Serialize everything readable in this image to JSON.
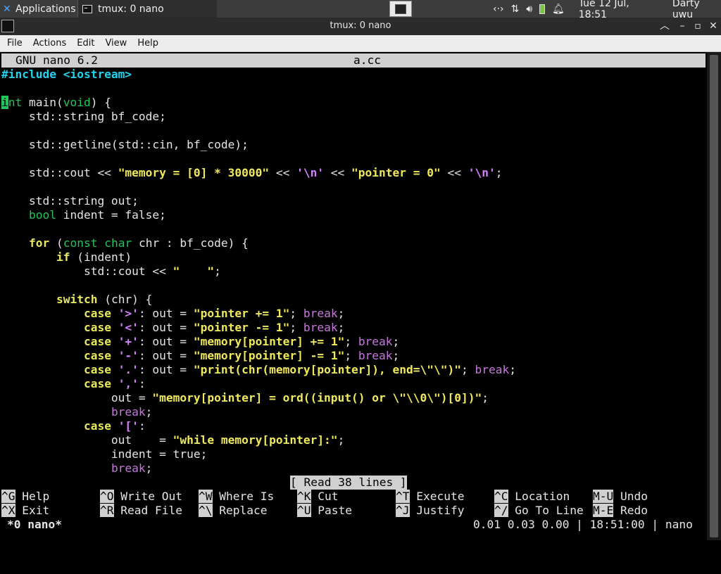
{
  "panel": {
    "apps_label": "Applications",
    "task_label": "tmux: 0 nano",
    "clock": "Tue 12 Jul, 18:51",
    "user": "Darty uwu"
  },
  "window": {
    "title": "tmux: 0 nano"
  },
  "menu": [
    "File",
    "Actions",
    "Edit",
    "View",
    "Help"
  ],
  "nano": {
    "version": "GNU nano 6.2",
    "filename": "a.cc",
    "status_message": "[ Read 38 lines ]",
    "shortcuts_row1": [
      {
        "key": "^G",
        "label": "Help"
      },
      {
        "key": "^O",
        "label": "Write Out"
      },
      {
        "key": "^W",
        "label": "Where Is"
      },
      {
        "key": "^K",
        "label": "Cut"
      },
      {
        "key": "^T",
        "label": "Execute"
      },
      {
        "key": "^C",
        "label": "Location"
      },
      {
        "key": "M-U",
        "label": "Undo"
      }
    ],
    "shortcuts_row2": [
      {
        "key": "^X",
        "label": "Exit"
      },
      {
        "key": "^R",
        "label": "Read File"
      },
      {
        "key": "^\\",
        "label": "Replace"
      },
      {
        "key": "^U",
        "label": "Paste"
      },
      {
        "key": "^J",
        "label": "Justify"
      },
      {
        "key": "^/",
        "label": "Go To Line"
      },
      {
        "key": "M-E",
        "label": "Redo"
      }
    ]
  },
  "tmux": {
    "window": "*0 nano*",
    "status_right": "0.01 0.03 0.00 | 18:51:00 | nano"
  },
  "code": [
    "#include <iostream>",
    "",
    "int main(void) {",
    "    std::string bf_code;",
    "",
    "    std::getline(std::cin, bf_code);",
    "",
    "    std::cout << \"memory = [0] * 30000\" << '\\n' << \"pointer = 0\" << '\\n';",
    "",
    "    std::string out;",
    "    bool indent = false;",
    "",
    "    for (const char chr : bf_code) {",
    "        if (indent)",
    "            std::cout << \"    \";",
    "",
    "        switch (chr) {",
    "            case '>': out = \"pointer += 1\"; break;",
    "            case '<': out = \"pointer -= 1\"; break;",
    "            case '+': out = \"memory[pointer] += 1\"; break;",
    "            case '-': out = \"memory[pointer] -= 1\"; break;",
    "            case '.': out = \"print(chr(memory[pointer]), end=\\\"\\\")\"; break;",
    "            case ',':",
    "                out = \"memory[pointer] = ord((input() or \\\"\\\\0\\\")[0])\";",
    "                break;",
    "            case '[':",
    "                out    = \"while memory[pointer]:\";",
    "                indent = true;",
    "                break;"
  ]
}
